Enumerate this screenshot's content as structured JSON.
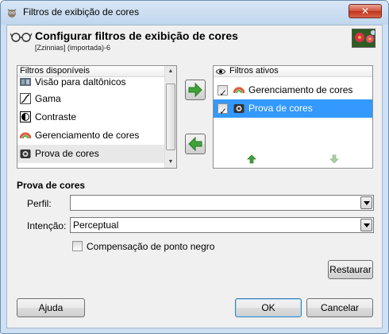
{
  "window": {
    "title": "Filtros de exibição de cores",
    "close_label": "✕"
  },
  "header": {
    "title": "Configurar filtros de exibição de cores",
    "subtitle": "[Zzinnias] (importada)-6"
  },
  "available": {
    "header": "Filtros disponíveis",
    "items": [
      {
        "label": "Visão para daltônicos",
        "icon": "color-deficient-icon"
      },
      {
        "label": "Gama",
        "icon": "gamma-icon"
      },
      {
        "label": "Contraste",
        "icon": "contrast-icon"
      },
      {
        "label": "Gerenciamento de cores",
        "icon": "color-management-icon"
      },
      {
        "label": "Prova de cores",
        "icon": "proof-icon"
      }
    ]
  },
  "active": {
    "header": "Filtros ativos",
    "items": [
      {
        "label": "Gerenciamento de cores",
        "checked": true,
        "icon": "color-management-icon"
      },
      {
        "label": "Prova de cores",
        "checked": true,
        "icon": "proof-icon",
        "selected": true
      }
    ]
  },
  "section": {
    "title": "Prova de cores",
    "profile_label": "Perfil:",
    "profile_value": "",
    "intent_label": "Intenção:",
    "intent_value": "Perceptual",
    "black_point_label": "Compensação de ponto negro",
    "black_point_checked": false,
    "reset_label": "Restaurar"
  },
  "footer": {
    "help_label": "Ajuda",
    "ok_label": "OK",
    "cancel_label": "Cancelar"
  },
  "colors": {
    "selection": "#3399ff",
    "arrow_green": "#3fa23a"
  }
}
